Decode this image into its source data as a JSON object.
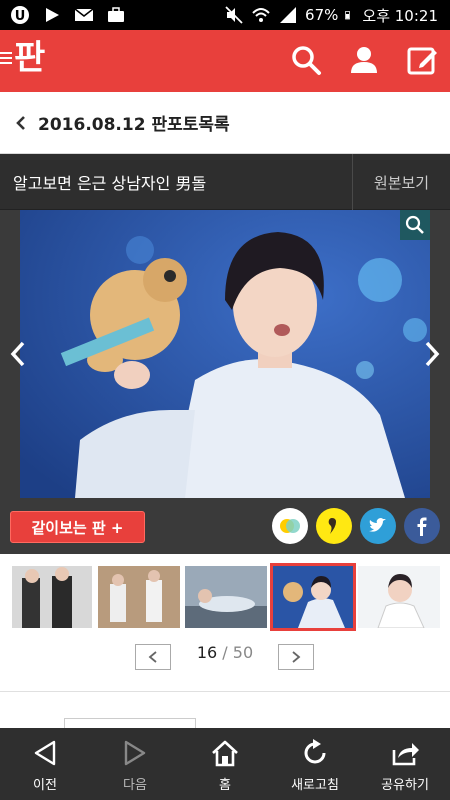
{
  "status_bar": {
    "battery": "67%",
    "time": "오후 10:21"
  },
  "app_header": {
    "logo": "판",
    "icons": [
      "search-icon",
      "user-icon",
      "edit-icon"
    ]
  },
  "breadcrumb": {
    "text": "2016.08.12 판포토목록"
  },
  "viewer": {
    "title": "알고보면 은근 상남자인 男돌",
    "original_label": "원본보기",
    "together_label": "같이보는 판 +",
    "share_icons": [
      "kakaostory-icon",
      "kakaotalk-icon",
      "twitter-icon",
      "facebook-icon"
    ]
  },
  "pager": {
    "current": "16",
    "separator": " / ",
    "total": "50"
  },
  "bottom_nav": {
    "prev": "이전",
    "next": "다음",
    "home": "홈",
    "refresh": "새로고침",
    "share": "공유하기"
  },
  "colors": {
    "brand": "#e8403c",
    "dark": "#3a3a3a",
    "nav": "#2f2f2f"
  }
}
